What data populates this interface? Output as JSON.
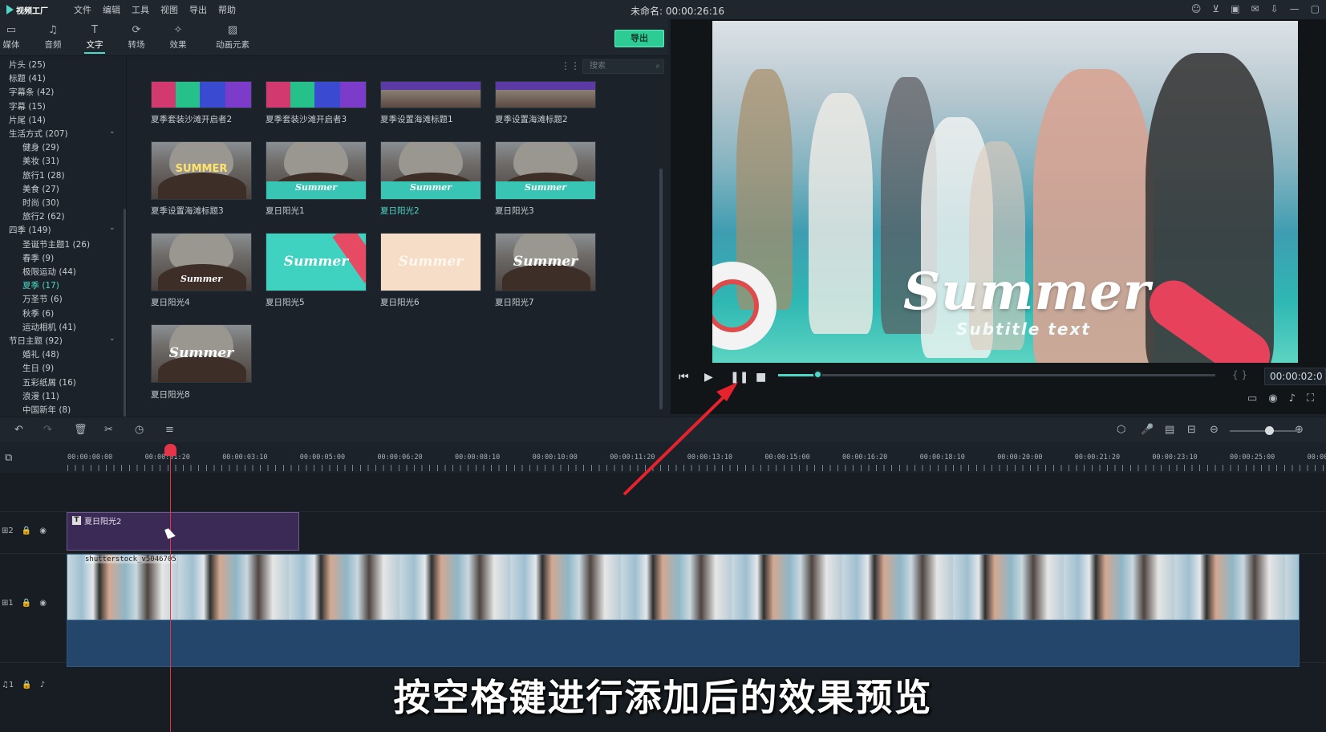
{
  "app": {
    "logo": "视频工厂",
    "project_title": "未命名: 00:00:26:16"
  },
  "menu": [
    "文件",
    "编辑",
    "工具",
    "视图",
    "导出",
    "帮助"
  ],
  "toolbar": {
    "items": [
      {
        "label": "媒体",
        "icon": "folder-icon"
      },
      {
        "label": "音频",
        "icon": "music-note-icon"
      },
      {
        "label": "文字",
        "icon": "text-icon"
      },
      {
        "label": "转场",
        "icon": "transition-icon"
      },
      {
        "label": "效果",
        "icon": "effects-icon"
      },
      {
        "label": "动画元素",
        "icon": "image-icon"
      }
    ],
    "active": "文字",
    "export_label": "导出"
  },
  "sidebar": {
    "categories": [
      {
        "label": "片头 (25)",
        "level": 0
      },
      {
        "label": "标题 (41)",
        "level": 0
      },
      {
        "label": "字幕条 (42)",
        "level": 0
      },
      {
        "label": "字幕 (15)",
        "level": 0
      },
      {
        "label": "片尾 (14)",
        "level": 0
      },
      {
        "label": "生活方式 (207)",
        "level": 0,
        "expandable": true
      },
      {
        "label": "健身 (29)",
        "level": 1
      },
      {
        "label": "美妆 (31)",
        "level": 1
      },
      {
        "label": "旅行1 (28)",
        "level": 1
      },
      {
        "label": "美食 (27)",
        "level": 1
      },
      {
        "label": "时尚 (30)",
        "level": 1
      },
      {
        "label": "旅行2 (62)",
        "level": 1
      },
      {
        "label": "四季 (149)",
        "level": 0,
        "expandable": true
      },
      {
        "label": "圣诞节主题1 (26)",
        "level": 1
      },
      {
        "label": "春季 (9)",
        "level": 1
      },
      {
        "label": "极限运动 (44)",
        "level": 1
      },
      {
        "label": "夏季 (17)",
        "level": 1,
        "selected": true
      },
      {
        "label": "万圣节 (6)",
        "level": 1
      },
      {
        "label": "秋季 (6)",
        "level": 1
      },
      {
        "label": "运动相机 (41)",
        "level": 1
      },
      {
        "label": "节日主题 (92)",
        "level": 0,
        "expandable": true
      },
      {
        "label": "婚礼 (48)",
        "level": 1
      },
      {
        "label": "生日 (9)",
        "level": 1
      },
      {
        "label": "五彩纸屑 (16)",
        "level": 1
      },
      {
        "label": "浪漫 (11)",
        "level": 1
      },
      {
        "label": "中国新年 (8)",
        "level": 1
      }
    ]
  },
  "library": {
    "search_placeholder": "搜索",
    "items": [
      {
        "label": "夏季套装沙滩开启者2",
        "thumb_text": ""
      },
      {
        "label": "夏季套装沙滩开启者3",
        "thumb_text": ""
      },
      {
        "label": "夏季设置海滩标题1",
        "thumb_text": ""
      },
      {
        "label": "夏季设置海滩标题2",
        "thumb_text": ""
      },
      {
        "label": "夏季设置海滩标题3",
        "thumb_text": "SUMMER"
      },
      {
        "label": "夏日阳光1",
        "thumb_text": "Summer"
      },
      {
        "label": "夏日阳光2",
        "thumb_text": "Summer",
        "highlight": true
      },
      {
        "label": "夏日阳光3",
        "thumb_text": "Summer"
      },
      {
        "label": "夏日阳光4",
        "thumb_text": "Summer"
      },
      {
        "label": "夏日阳光5",
        "thumb_text": "Summer"
      },
      {
        "label": "夏日阳光6",
        "thumb_text": "Summer"
      },
      {
        "label": "夏日阳光7",
        "thumb_text": "Summer"
      },
      {
        "label": "夏日阳光8",
        "thumb_text": "Summer"
      }
    ]
  },
  "preview": {
    "title_text": "Summer",
    "subtitle_text": "Subtitle text",
    "timecode": "00:00:02:0",
    "progress": 0.09,
    "brace_left": "{",
    "brace_right": "}"
  },
  "timeline": {
    "ruler_labels": [
      "00:00:00:00",
      "00:00:01:20",
      "00:00:03:10",
      "00:00:05:00",
      "00:00:06:20",
      "00:00:08:10",
      "00:00:10:00",
      "00:00:11:20",
      "00:00:13:10",
      "00:00:15:00",
      "00:00:16:20",
      "00:00:18:10",
      "00:00:20:00",
      "00:00:21:20",
      "00:00:23:10",
      "00:00:25:00",
      "00:00"
    ],
    "tracks": [
      {
        "id": "2",
        "type": "video"
      },
      {
        "id": "1",
        "type": "video"
      },
      {
        "id": "1",
        "type": "audio"
      }
    ],
    "text_clip_label": "夏日阳光2",
    "video_clip_label": "shutterstock_v5046705"
  },
  "caption": "按空格键进行添加后的效果预览",
  "colors": {
    "accent": "#4fd6c6",
    "export": "#2ecc95",
    "playhead": "#e6344a",
    "arrow": "#e8222d"
  }
}
